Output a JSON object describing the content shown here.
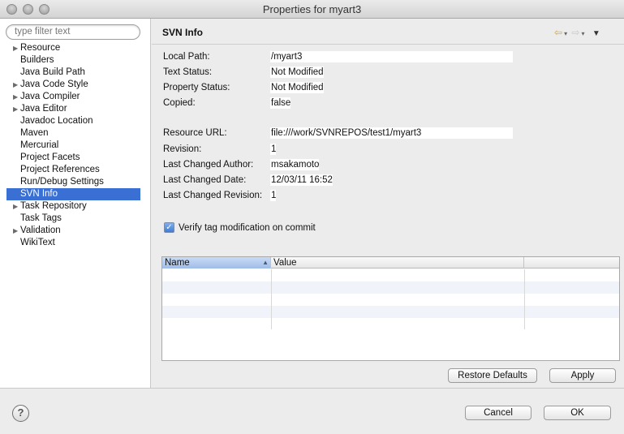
{
  "window": {
    "title": "Properties for myart3"
  },
  "filter": {
    "placeholder": "type filter text"
  },
  "tree": [
    {
      "label": "Resource",
      "expandable": true
    },
    {
      "label": "Builders",
      "expandable": false
    },
    {
      "label": "Java Build Path",
      "expandable": false
    },
    {
      "label": "Java Code Style",
      "expandable": true
    },
    {
      "label": "Java Compiler",
      "expandable": true
    },
    {
      "label": "Java Editor",
      "expandable": true
    },
    {
      "label": "Javadoc Location",
      "expandable": false
    },
    {
      "label": "Maven",
      "expandable": false
    },
    {
      "label": "Mercurial",
      "expandable": false
    },
    {
      "label": "Project Facets",
      "expandable": false
    },
    {
      "label": "Project References",
      "expandable": false
    },
    {
      "label": "Run/Debug Settings",
      "expandable": false
    },
    {
      "label": "SVN Info",
      "expandable": false,
      "selected": true
    },
    {
      "label": "Task Repository",
      "expandable": true
    },
    {
      "label": "Task Tags",
      "expandable": false
    },
    {
      "label": "Validation",
      "expandable": true
    },
    {
      "label": "WikiText",
      "expandable": false
    }
  ],
  "page": {
    "title": "SVN Info"
  },
  "info": {
    "local_path": {
      "label": "Local Path:",
      "value": "/myart3"
    },
    "text_status": {
      "label": "Text Status:",
      "value": "Not Modified"
    },
    "property_status": {
      "label": "Property Status:",
      "value": "Not Modified"
    },
    "copied": {
      "label": "Copied:",
      "value": "false"
    },
    "resource_url": {
      "label": "Resource URL:",
      "value": "file:///work/SVNREPOS/test1/myart3"
    },
    "revision": {
      "label": "Revision:",
      "value": "1"
    },
    "last_changed_author": {
      "label": "Last Changed Author:",
      "value": "msakamoto"
    },
    "last_changed_date": {
      "label": "Last Changed Date:",
      "value": "12/03/11 16:52"
    },
    "last_changed_revision": {
      "label": "Last Changed Revision:",
      "value": "1"
    }
  },
  "verify": {
    "label": "Verify tag modification on commit",
    "checked": true
  },
  "table": {
    "columns": [
      "Name",
      "Value"
    ]
  },
  "buttons": {
    "restore_defaults": "Restore Defaults",
    "apply": "Apply",
    "cancel": "Cancel",
    "ok": "OK"
  },
  "icons": {
    "back": "back-arrow-icon",
    "forward": "forward-arrow-icon",
    "view_menu": "view-menu-icon",
    "help": "help-icon",
    "sort": "sort-ascending-icon"
  },
  "colors": {
    "selection": "#3a70d4",
    "back_arrow": "#e3a31b"
  }
}
